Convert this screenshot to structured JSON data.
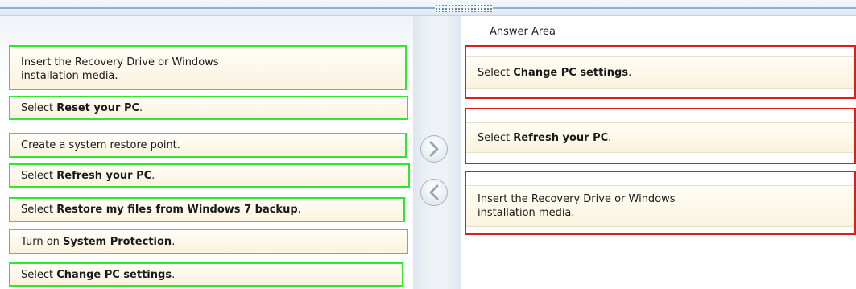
{
  "source_items": [
    {
      "pre": "Insert the Recovery Drive or Windows",
      "line2": "installation media.",
      "bold": "",
      "post": ""
    },
    {
      "pre": "Select ",
      "bold": "Reset your PC",
      "post": "."
    },
    {
      "pre": "Create a system restore point.",
      "bold": "",
      "post": ""
    },
    {
      "pre": "Select ",
      "bold": "Refresh your PC",
      "post": "."
    },
    {
      "pre": "Select ",
      "bold": "Restore my files from Windows 7 backup",
      "post": "."
    },
    {
      "pre": "Turn on ",
      "bold": "System Protection",
      "post": "."
    },
    {
      "pre": "Select ",
      "bold": "Change PC settings",
      "post": "."
    }
  ],
  "answer_area": {
    "title": "Answer Area",
    "slots": [
      {
        "pre": "Select ",
        "bold": "Change PC settings",
        "post": "."
      },
      {
        "pre": "Select ",
        "bold": "Refresh your PC",
        "post": "."
      },
      {
        "pre": "Insert the Recovery Drive or Windows",
        "line2": "installation media.",
        "bold": "",
        "post": ""
      }
    ]
  },
  "controls": {
    "move_right_icon": "chevron-right-icon",
    "move_left_icon": "chevron-left-icon"
  },
  "colors": {
    "source_border": "#2ee82e",
    "answer_border": "#e01c1c",
    "item_bg": "#fbf3de"
  }
}
